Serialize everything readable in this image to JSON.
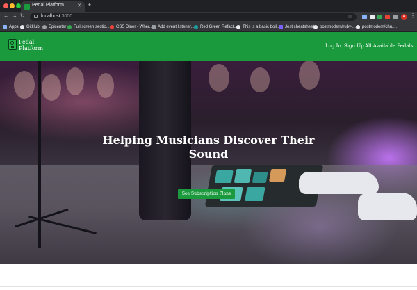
{
  "browser": {
    "tab_title": "Pedal Platform",
    "url_host": "localhost",
    "url_port": ":3000",
    "bookmarks": [
      {
        "label": "Apps",
        "icon": "apps-grid-icon",
        "color": "#8ab4f8"
      },
      {
        "label": "GitHub",
        "icon": "github-icon",
        "color": "#e8eaed"
      },
      {
        "label": "Epicenter",
        "icon": "epicenter-icon",
        "color": "#9aa0a6"
      },
      {
        "label": "Full screen sectio...",
        "icon": "page-icon",
        "color": "#34a853"
      },
      {
        "label": "CSS Diner - Wher...",
        "icon": "css-diner-icon",
        "color": "#ea4335"
      },
      {
        "label": "Add event listener...",
        "icon": "page-icon",
        "color": "#9aa0a6"
      },
      {
        "label": "Red Green Refact...",
        "icon": "page-icon",
        "color": "#1a9a9a"
      },
      {
        "label": "This is a basic boil...",
        "icon": "github-icon",
        "color": "#e8eaed"
      },
      {
        "label": "Jest cheatsheet",
        "icon": "jest-icon",
        "color": "#7b61ff"
      },
      {
        "label": "postmodern/ruby-...",
        "icon": "github-icon",
        "color": "#e8eaed"
      },
      {
        "label": "postmodern/chru...",
        "icon": "github-icon",
        "color": "#e8eaed"
      }
    ],
    "profile_initial": "A"
  },
  "header": {
    "logo_line1": "Pedal",
    "logo_line2": "Platform",
    "nav": [
      "Log In",
      "Sign Up",
      "All Available Pedals"
    ],
    "bg_color": "#1a9a3d"
  },
  "hero": {
    "title_line1": "Helping Musicians Discover Their",
    "title_line2": "Sound",
    "cta_label": "See Subscription Plans"
  }
}
